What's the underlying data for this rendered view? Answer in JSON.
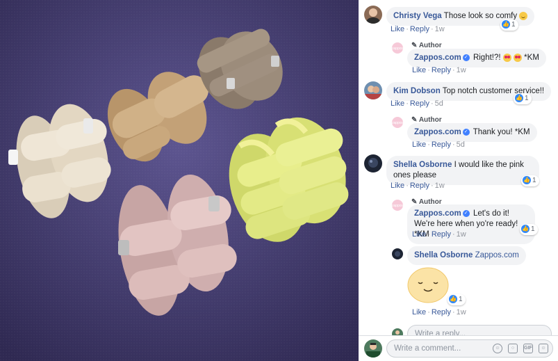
{
  "comments": [
    {
      "name": "Christy Vega",
      "text": "Those look so comfy",
      "like": "Like",
      "reply": "Reply",
      "time": "1w",
      "reactions": "1"
    },
    {
      "author_label": "Author",
      "name": "Zappos.com",
      "text": "Right!?! *KM",
      "like": "Like",
      "reply": "Reply",
      "time": "1w"
    },
    {
      "name": "Kim Dobson",
      "text": "Top notch customer service!!",
      "like": "Like",
      "reply": "Reply",
      "time": "5d",
      "reactions": "1"
    },
    {
      "author_label": "Author",
      "name": "Zappos.com",
      "text": "Thank you! *KM",
      "like": "Like",
      "reply": "Reply",
      "time": "5d"
    },
    {
      "name": "Shella Osborne",
      "text": "I would like the pink ones please",
      "like": "Like",
      "reply": "Reply",
      "time": "1w",
      "reactions": "1"
    },
    {
      "author_label": "Author",
      "name": "Zappos.com",
      "text": "Let's do it! We're here when yo're ready! *KM",
      "like": "Like",
      "reply": "Reply",
      "time": "1w",
      "reactions": "1"
    },
    {
      "name": "Shella Osborne",
      "text": "Zappos.com",
      "like": "Like",
      "reply": "Reply",
      "time": "1w",
      "reactions": "1"
    }
  ],
  "reply_input": {
    "placeholder": "Write a reply..."
  },
  "comment_input": {
    "placeholder": "Write a comment..."
  },
  "toolbar_icons": [
    "emoji-icon",
    "camera-icon",
    "gif-icon",
    "sticker-icon"
  ],
  "colors": {
    "link": "#385898",
    "bubble": "#f2f3f5",
    "like_blue": "#2d88ff",
    "photo_bg": "#4a4275"
  }
}
